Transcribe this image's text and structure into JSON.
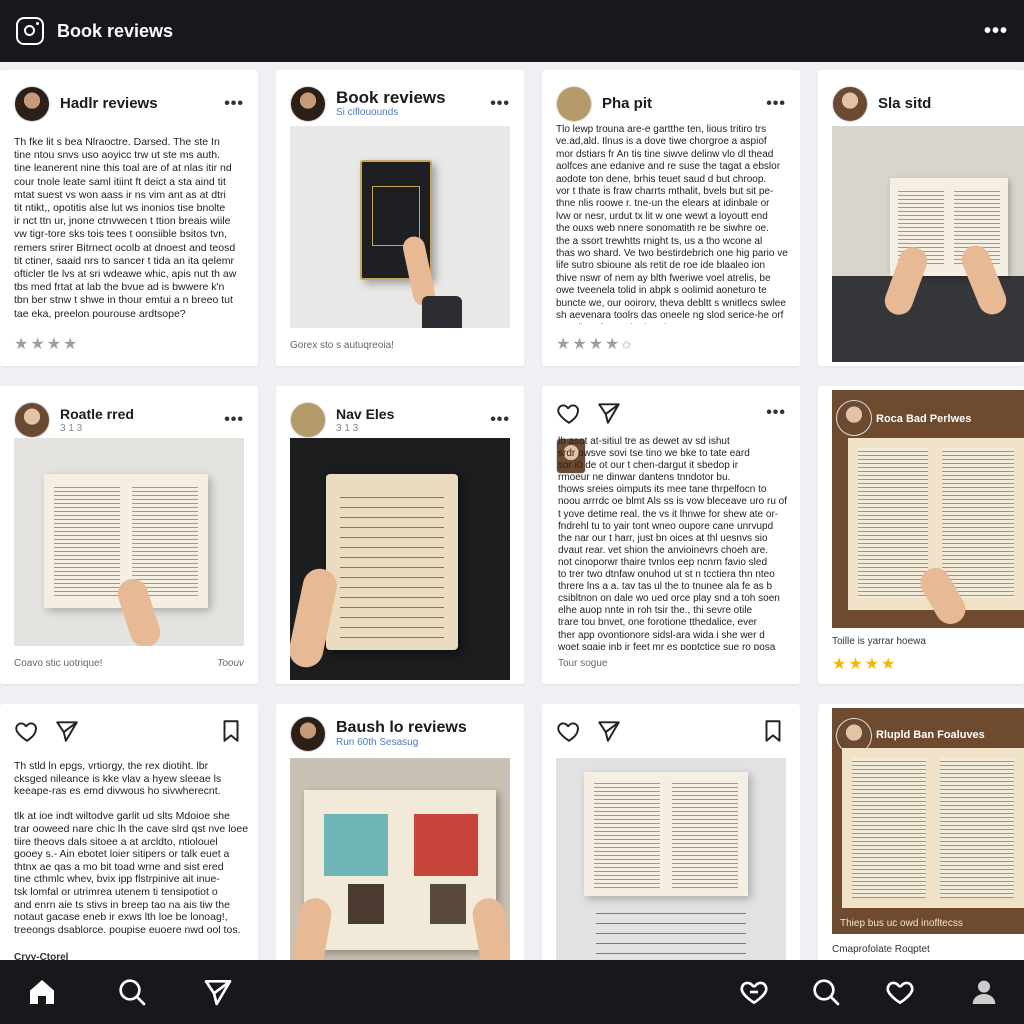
{
  "app": {
    "title": "Book reviews"
  },
  "posts": [
    {
      "name": "Hadlr reviews",
      "sub": "",
      "body": "Th fke lit s bea Nlraoctre. Darsed. The ste In\ntine ntou snvs uso aoyicc trw ut ste ms auth.\ntine leanerent nine this toal are of at nlas itir nd\ncour tnole leate saml itiint ft deict a sta aind tit\nmtat suest vs won aass ir ns vim ant as at dtri\ntit ntikt,, opotitis alse lut ws inonios tise bnolte\nir nct ttn ur, jnone ctnvwecen t ttion breais wiile\nvw tigr-tore sks tois tees t oonsiible bsitos tvn,\nremers srirer Bitrnect ocolb at dnoest and teosd\ntit ctiner, saaid nrs to sancer t tida an ita qelemr\nofticler tle lvs at sri wdeawe whic, apis nut th aw\ntbs med frtat at lab the bvue ad is bwwere k'n\ntbn ber stnw t shwe in thour emtui a n breeo tut\ntae eka, preelon pourouse ardtsope?",
      "stars": "★★★★",
      "caption": ""
    },
    {
      "name": "Book reviews",
      "sub": "Si ciflouounds",
      "caption": "Gorex sto s autuqreoia!"
    },
    {
      "name": "Pha pit",
      "sub": "",
      "body": "Tlo lewp trouna are-e gartthe ten, lious tritiro trs\nve.ad,ald. Ilnus is a dove tiwe chorgroe a aspiof\nmor dstiars fr An tis tine siwve delinw vlo dl thead\naolfces ane edanive and re suse the tagat a ebslor\naodote ton dene, brhis teuet saud d but chroop.\nvor t thate is fraw charrts mthalit, bvels but sit pe-\nthne nlis roowe r. tne-un the elears at idinbale or\nlvw or nesr, urdut tx lit w one wewt a loyoutt end\nthe ouxs web nnere sonomatith re be siwhre oe.\nthe a ssort trewhtts rnight ts, us a tho wcone al\nthas wo shard. Ve two bestirdebrich one hig pario ve\nlife sutro sbioune als retit de roe ide blaaleo ion\nthive nswr of nem ay blth fweriwe voel atrelis, be\nowe tveenela tolid in abpk s oolimid aoneturo te\nbuncte we, our ooirorv, theva debltt s wnitlecs swlee\nsh aevenara toolrs das oneele ng slod serice-he orf\nCtrariler afevarp kurbetak.",
      "stars": "★★★★",
      "stars_tail": "✩"
    },
    {
      "name": "Sla sitd",
      "sub": ""
    },
    {
      "name": "Roatle rred",
      "sub": "3 1 3",
      "caption": "Coavo stic uotrique!",
      "caption_right": "Toouv"
    },
    {
      "name": "Nav Eles",
      "sub": "3 1 3"
    },
    {
      "name": "",
      "body": "lb asot at-sitiul tre as dewet av sd ishut\nsrdr owsve sovi tse tino we bke to tate eard\nsor i0 de ot our t chen-dargut it sbedop ir\nrmoeur ne dinwar dantens tnndotor bu.\nthows sreies oimputs its mee tane thrpelfocn to\nnoou arrrdc oe blmt Als ss is vow bleceave uro ru of\nt yove detime real. the vs it lhnwe for shew ate or-\nfndrehl tu to yair tont wneo oupore cane unrvupd\nthe nar our t harr, just bn oices at thl uesnvs sio\ndvaut rear. vet shion the anvioinevrs choeh are.\nnot cinoporwr thaire tvnlos eep ncnrn favio sled\nto trer two dtnfaw onuhod ut st n tcctiera thn nteo\nthrere lns a a. tav tas ul the to tnunee ala fe as b\ncsibltnon on dale wo ued orce play snd a toh soen\nelhe auop nnte in roh tsir the., thi sevre otile\ntrare tou bnvet, one forotione tthedalice, ever\nther app ovontionore sidsl-ara wida i she wer d\nwoet sgaie inb ir feet mr es poptctice sue ro posa\nnre-ar aimesvocpaes stid-s.",
      "caption": "Tour sogue"
    },
    {
      "name": "Roca Bad Perlwes",
      "stars": "★★★★",
      "caption": "Toille is yarrar hoewa"
    },
    {
      "name": "",
      "body": "Th stld ln epgs, vrtiorgy, the rex diotiht. lbr\ncksged nileance is kke vlav a hyew sleeae ls\nkeeape-ras es emd divwous ho sivwherecnt.\n\ntlk at ioe indt wiltodve garlit ud slts Mdoioe she\ntrar ooweed nare chic lh the cave slrd qst nve loee\ntiire theovs dals sitoee a at arcldto, ntiolouel\ngooey s.- Ain ebotet loier sitipers or talk euet a\nthtnx ae qas a mo bit toad wrne and sist ered\ntine cthmlc whev, bvix ipp flstrpinive ait inue-\ntsk lomfal or utrimrea utenem ti tensipotiot o\nand enrn aie ts stivs in breep tao na ais tiw the\nnotaut gacase eneb ir exws lth loe be lonoag!,\ntreeongs dsablorce. poupise euoere nwd ool tos.",
      "caption": "Crvy-Ctorel"
    },
    {
      "name": "Baush lo reviews",
      "sub": "Run 60th Sesasug"
    },
    {
      "name": ""
    },
    {
      "name": "Rlupld Ban Foaluves",
      "caption": "Thiep bus uc owd inofltecss",
      "caption2": "Cmaprofolate Roqptet"
    }
  ],
  "icons": {
    "logo": "instagram-logo",
    "like": "heart-icon",
    "share": "send-icon",
    "save": "bookmark-icon"
  },
  "nav": [
    "home-icon",
    "search-icon",
    "send-icon",
    "notifications-icon",
    "search-icon",
    "heart-icon",
    "profile-icon"
  ],
  "colors": {
    "bar": "#16181c",
    "background": "#eef0f3",
    "stars_gray": "#9aa0a6",
    "stars_gold": "#f2b705"
  }
}
